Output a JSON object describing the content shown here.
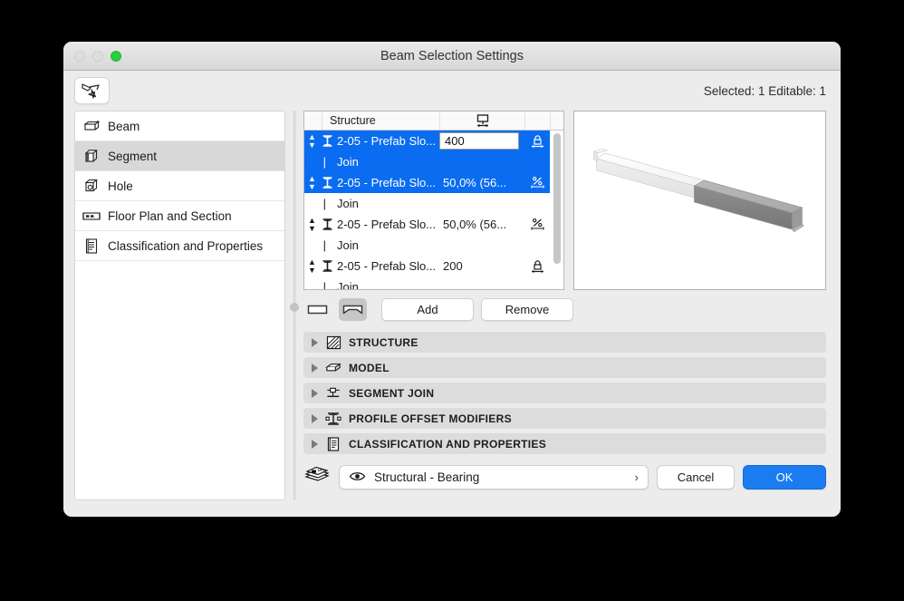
{
  "window": {
    "title": "Beam Selection Settings",
    "traffic_lights": [
      "close-disabled",
      "minimize-disabled",
      "zoom-green"
    ]
  },
  "toolbar": {
    "tool_icon": "arrow-star-selection-icon",
    "selection_status": "Selected: 1 Editable: 1"
  },
  "sidebar": {
    "items": [
      {
        "label": "Beam",
        "icon": "beam-icon",
        "active": false
      },
      {
        "label": "Segment",
        "icon": "segment-icon",
        "active": true
      },
      {
        "label": "Hole",
        "icon": "hole-icon",
        "active": false
      },
      {
        "label": "Floor Plan and Section",
        "icon": "floor-plan-icon",
        "active": false
      },
      {
        "label": "Classification and Properties",
        "icon": "classification-icon",
        "active": false
      }
    ]
  },
  "table": {
    "headers": {
      "structure": "Structure",
      "length_icon": "length-dimension-icon"
    },
    "rows": [
      {
        "type": "segment",
        "name": "2-05 - Prefab Slo...",
        "value": "400",
        "editing": true,
        "selected": true,
        "end_icon": "lock-icon"
      },
      {
        "type": "join",
        "label": "Join",
        "selected": true
      },
      {
        "type": "segment",
        "name": "2-05 - Prefab Slo...",
        "value": "50,0% (56...",
        "editing": false,
        "selected": true,
        "end_icon": "percent-icon"
      },
      {
        "type": "join",
        "label": "Join",
        "selected": false
      },
      {
        "type": "segment",
        "name": "2-05 - Prefab Slo...",
        "value": "50,0% (56...",
        "editing": false,
        "selected": false,
        "end_icon": "percent-icon"
      },
      {
        "type": "join",
        "label": "Join",
        "selected": false
      },
      {
        "type": "segment",
        "name": "2-05 - Prefab Slo...",
        "value": "200",
        "editing": false,
        "selected": false,
        "end_icon": "lock-icon"
      },
      {
        "type": "join",
        "label": "Join",
        "selected": false
      }
    ]
  },
  "table_tools": {
    "toggle_straight": "straight-segment-icon",
    "toggle_tapered": "tapered-segment-icon",
    "add_label": "Add",
    "remove_label": "Remove"
  },
  "preview": {
    "name": "beam-3d-preview"
  },
  "sections": [
    {
      "label": "STRUCTURE",
      "icon": "hatch-pattern-icon"
    },
    {
      "label": "MODEL",
      "icon": "model-box-icon"
    },
    {
      "label": "SEGMENT JOIN",
      "icon": "segment-join-icon"
    },
    {
      "label": "PROFILE OFFSET MODIFIERS",
      "icon": "profile-offset-icon"
    },
    {
      "label": "CLASSIFICATION AND PROPERTIES",
      "icon": "classification-icon"
    }
  ],
  "footer": {
    "layers_icon": "layers-stack-icon",
    "eye_icon": "eye-icon",
    "layer_value": "Structural - Bearing",
    "chevron": "›",
    "cancel_label": "Cancel",
    "ok_label": "OK"
  },
  "colors": {
    "selection_blue": "#0a6cf0",
    "ok_blue": "#1a7cf0",
    "window_bg": "#ececec",
    "section_bg": "#dcdcdc",
    "green_light": "#28cd41"
  }
}
